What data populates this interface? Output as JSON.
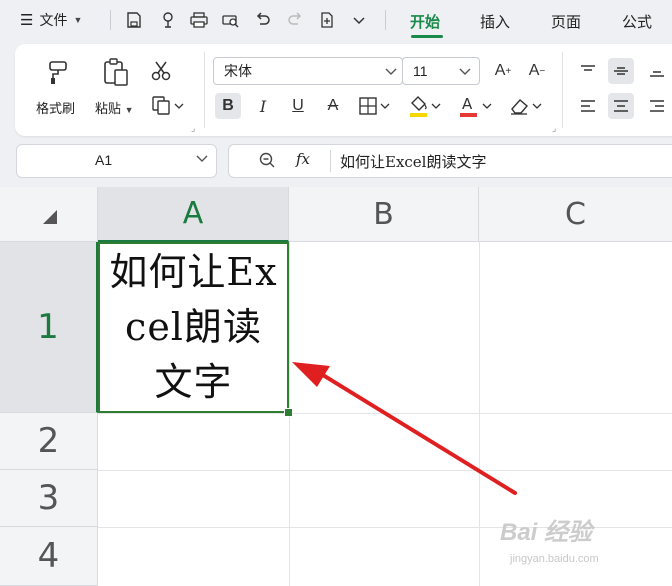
{
  "menubar": {
    "file_label": "文件",
    "tabs": [
      "开始",
      "插入",
      "页面",
      "公式"
    ],
    "active_tab": "开始",
    "accent_color": "#1a8a4a"
  },
  "ribbon": {
    "format_painter": "格式刷",
    "paste": "粘贴",
    "font_name": "宋体",
    "font_size": "11",
    "font_color": "#e53935",
    "highlight_color": "#f5d800"
  },
  "formula_bar": {
    "name_box": "A1",
    "fx_label": "fx",
    "content": "如何让Excel朗读文字"
  },
  "grid": {
    "columns": [
      "A",
      "B",
      "C"
    ],
    "rows": [
      "1",
      "2",
      "3",
      "4"
    ],
    "selected_cell": "A1",
    "cell_a1": "如何让Excel朗读文字",
    "selection_color": "#2f7d32"
  },
  "annotation": {
    "arrow_color": "#e02020"
  },
  "watermark": {
    "text": "Bai 经验",
    "sub": "jingyan.baidu.com"
  }
}
